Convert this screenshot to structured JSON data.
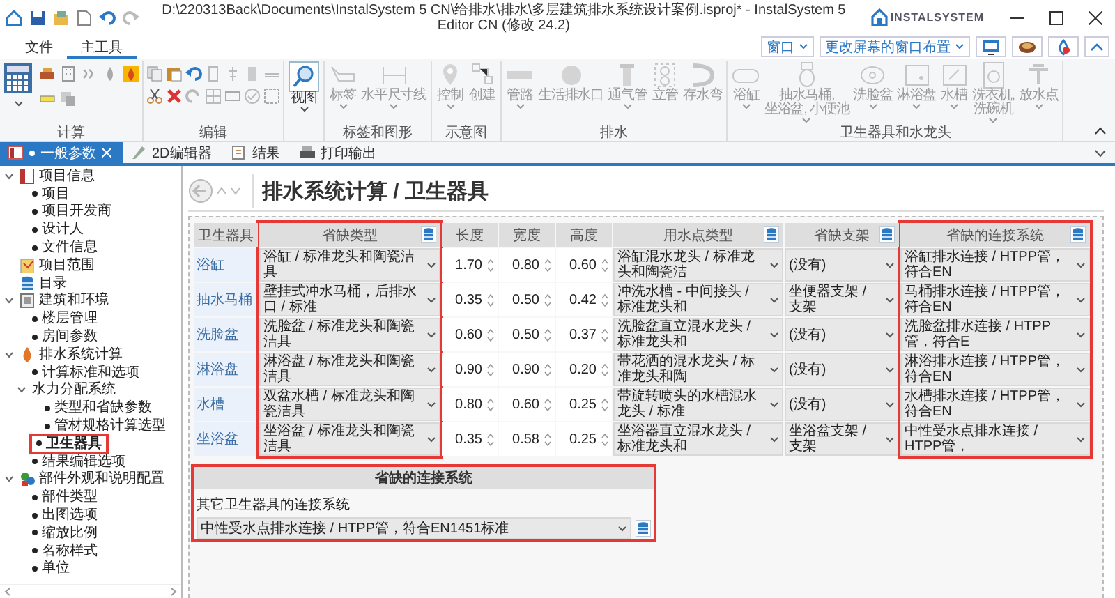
{
  "window": {
    "title": "D:\\220313Back\\Documents\\InstalSystem 5 CN\\给排水\\排水\\多层建筑排水系统设计案例.isproj* - InstalSystem 5 Editor CN (修改 24.2)",
    "logo": "INSTALSYSTEM"
  },
  "ribbon": {
    "tabs": [
      {
        "label": "文件",
        "selected": false
      },
      {
        "label": "主工具",
        "selected": true
      }
    ],
    "window_menu": "窗口",
    "layout_menu": "更改屏幕的窗口布置",
    "groups": [
      {
        "kind": "calc",
        "label": "计算"
      },
      {
        "kind": "edit",
        "label": "编辑"
      },
      {
        "kind": "buttons",
        "buttons": [
          {
            "label": "视图",
            "disabled": false,
            "dropdown": true
          }
        ]
      },
      {
        "kind": "buttons",
        "label": "标签和图形",
        "buttons": [
          {
            "label": "标签",
            "disabled": true,
            "dropdown": true
          },
          {
            "label": "水平尺寸线",
            "disabled": true,
            "dropdown": true
          }
        ]
      },
      {
        "kind": "buttons",
        "label": "示意图",
        "buttons": [
          {
            "label": "控制",
            "disabled": true,
            "dropdown": true
          },
          {
            "label": "创建",
            "disabled": true,
            "dropdown": false
          }
        ]
      },
      {
        "kind": "buttons",
        "label": "排水",
        "buttons": [
          {
            "label": "管路",
            "disabled": true,
            "dropdown": true
          },
          {
            "label": "生活排水口",
            "disabled": true,
            "dropdown": false
          },
          {
            "label": "通气管",
            "disabled": true,
            "dropdown": true
          },
          {
            "label": "立管",
            "disabled": true,
            "dropdown": false
          },
          {
            "label": "存水弯",
            "disabled": true,
            "dropdown": false
          }
        ]
      },
      {
        "kind": "buttons",
        "label": "卫生器具和水龙头",
        "buttons": [
          {
            "label": "浴缸",
            "disabled": true,
            "dropdown": true
          },
          {
            "label": "抽水马桶,\n坐浴盆, 小便池",
            "disabled": true,
            "dropdown": true
          },
          {
            "label": "洗脸盆",
            "disabled": true,
            "dropdown": true
          },
          {
            "label": "淋浴盘",
            "disabled": true,
            "dropdown": true
          },
          {
            "label": "水槽",
            "disabled": true,
            "dropdown": true
          },
          {
            "label": "洗衣机,\n洗碗机",
            "disabled": true,
            "dropdown": true
          },
          {
            "label": "放水点",
            "disabled": true,
            "dropdown": true
          }
        ]
      }
    ]
  },
  "doc_tabs": [
    {
      "label": "一般参数",
      "selected": true,
      "closable": true
    },
    {
      "label": "2D编辑器",
      "selected": false,
      "closable": false
    },
    {
      "label": "结果",
      "selected": false,
      "closable": false
    },
    {
      "label": "打印输出",
      "selected": false,
      "closable": false
    }
  ],
  "sidebar": {
    "items": [
      {
        "label": "项目信息",
        "kind": "icon",
        "selected": false,
        "highlighted": false,
        "expanded": true,
        "children": [
          {
            "label": "项目",
            "kind": "bullet",
            "selected": false,
            "highlighted": false
          },
          {
            "label": "项目开发商",
            "kind": "bullet",
            "selected": false,
            "highlighted": false
          },
          {
            "label": "设计人",
            "kind": "bullet",
            "selected": false,
            "highlighted": false
          },
          {
            "label": "文件信息",
            "kind": "bullet",
            "selected": false,
            "highlighted": false
          }
        ]
      },
      {
        "label": "项目范围",
        "kind": "icon",
        "selected": false,
        "highlighted": false
      },
      {
        "label": "目录",
        "kind": "icon",
        "selected": false,
        "highlighted": false
      },
      {
        "label": "建筑和环境",
        "kind": "icon",
        "selected": false,
        "highlighted": false,
        "expanded": true,
        "children": [
          {
            "label": "楼层管理",
            "kind": "bullet",
            "selected": false,
            "highlighted": false
          },
          {
            "label": "房间参数",
            "kind": "bullet",
            "selected": false,
            "highlighted": false
          }
        ]
      },
      {
        "label": "排水系统计算",
        "kind": "icon",
        "selected": false,
        "highlighted": false,
        "expanded": true,
        "children": [
          {
            "label": "计算标准和选项",
            "kind": "bullet",
            "selected": false,
            "highlighted": false
          },
          {
            "label": "水力分配系统",
            "kind": "plain",
            "selected": false,
            "highlighted": false,
            "expanded": true,
            "children": [
              {
                "label": "类型和省缺参数",
                "kind": "bullet",
                "selected": false,
                "highlighted": false
              },
              {
                "label": "管材规格计算选型",
                "kind": "bullet",
                "selected": false,
                "highlighted": false
              }
            ]
          },
          {
            "label": "卫生器具",
            "kind": "bullet",
            "selected": true,
            "highlighted": true
          },
          {
            "label": "结果编辑选项",
            "kind": "bullet",
            "selected": false,
            "highlighted": false
          }
        ]
      },
      {
        "label": "部件外观和说明配置",
        "kind": "icon",
        "selected": false,
        "highlighted": false,
        "expanded": true,
        "children": [
          {
            "label": "部件类型",
            "kind": "bullet",
            "selected": false,
            "highlighted": false
          },
          {
            "label": "出图选项",
            "kind": "bullet",
            "selected": false,
            "highlighted": false
          },
          {
            "label": "缩放比例",
            "kind": "bullet",
            "selected": false,
            "highlighted": false
          },
          {
            "label": "名称样式",
            "kind": "bullet",
            "selected": false,
            "highlighted": false
          },
          {
            "label": "单位",
            "kind": "bullet",
            "selected": false,
            "highlighted": false
          }
        ]
      }
    ]
  },
  "panel": {
    "title": "排水系统计算 / 卫生器具",
    "table": {
      "columns": [
        {
          "title": "卫生器具",
          "kind": "label",
          "highlighted": false
        },
        {
          "title": "省缺类型",
          "kind": "select",
          "highlighted": true
        },
        {
          "title": "长度",
          "kind": "number",
          "highlighted": false
        },
        {
          "title": "宽度",
          "kind": "number",
          "highlighted": false
        },
        {
          "title": "高度",
          "kind": "number",
          "highlighted": false
        },
        {
          "title": "用水点类型",
          "kind": "select",
          "highlighted": false
        },
        {
          "title": "省缺支架",
          "kind": "select",
          "highlighted": false
        },
        {
          "title": "省缺的连接系统",
          "kind": "select",
          "highlighted": true
        }
      ],
      "rows": [
        [
          "浴缸",
          "浴缸 / 标准龙头和陶瓷洁具",
          "1.70",
          "0.80",
          "0.60",
          "浴缸混水龙头 / 标准龙头和陶瓷洁",
          "(没有)",
          "浴缸排水连接 / HTPP管，符合EN"
        ],
        [
          "抽水马桶",
          "壁挂式冲水马桶，后排水口 / 标准",
          "0.35",
          "0.50",
          "0.42",
          "冲洗水槽 - 中间接头 / 标准龙头和",
          "坐便器支架 / 支架",
          "马桶排水连接 / HTPP管，符合EN"
        ],
        [
          "洗脸盆",
          "洗脸盆 / 标准龙头和陶瓷洁具",
          "0.60",
          "0.50",
          "0.37",
          "洗脸盆直立混水龙头 / 标准龙头和",
          "(没有)",
          "洗脸盆排水连接 / HTPP管，符合E"
        ],
        [
          "淋浴盘",
          "淋浴盘 / 标准龙头和陶瓷洁具",
          "0.90",
          "0.90",
          "0.20",
          "带花洒的混水龙头 / 标准龙头和陶",
          "(没有)",
          "淋浴排水连接 / HTPP管，符合EN"
        ],
        [
          "水槽",
          "双盆水槽 / 标准龙头和陶瓷洁具",
          "0.80",
          "0.60",
          "0.25",
          "带旋转喷头的水槽混水龙头 / 标准",
          "(没有)",
          "水槽排水连接 / HTPP管，符合EN"
        ],
        [
          "坐浴盆",
          "坐浴盆 / 标准龙头和陶瓷洁具",
          "0.35",
          "0.58",
          "0.25",
          "坐浴器直立混水龙头 / 标准龙头和",
          "坐浴盆支架 / 支架",
          "中性受水点排水连接 / HTPP管，"
        ]
      ]
    },
    "default_box": {
      "title": "省缺的连接系统",
      "label": "其它卫生器具的连接系统",
      "value": "中性受水点排水连接 / HTPP管，符合EN1451标准",
      "highlighted": true
    }
  }
}
